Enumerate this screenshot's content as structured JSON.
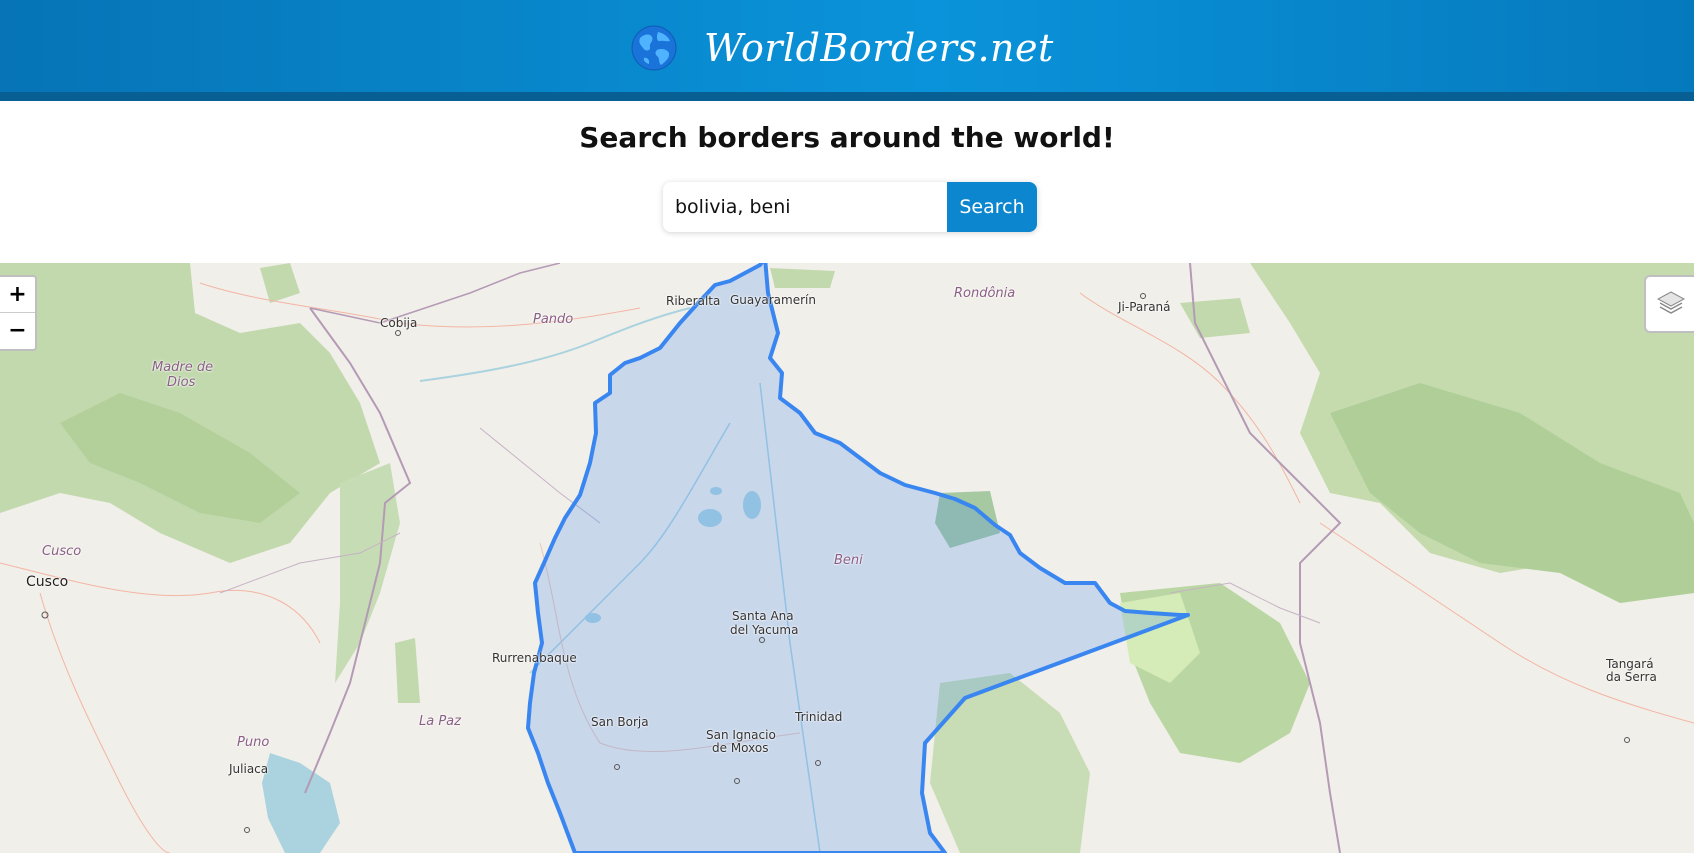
{
  "header": {
    "brand_name": "WorldBorders.net",
    "logo_icon": "globe-icon",
    "colors": {
      "primary": "#0a8ed6",
      "dark": "#085f93"
    }
  },
  "search": {
    "headline": "Search borders around the world!",
    "query": "bolivia, beni",
    "button_label": "Search"
  },
  "map": {
    "highlight_color": "#3a86f0",
    "controls": {
      "zoom_in": "+",
      "zoom_out": "−",
      "layers_icon": "layers-icon"
    },
    "labels": {
      "riberalta": "Riberalta",
      "guayaramerin": "Guayaramerín",
      "rondonia": "Rondônia",
      "ji_parana": "Ji-Paraná",
      "cobija": "Cobija",
      "pando": "Pando",
      "madre_de_dios_1": "Madre de",
      "madre_de_dios_2": "Dios",
      "cusco_region": "Cusco",
      "cusco_city": "Cusco",
      "santa_ana_1": "Santa Ana",
      "santa_ana_2": "del Yacuma",
      "beni": "Beni",
      "rurrenabaque": "Rurrenabaque",
      "san_borja": "San Borja",
      "trinidad": "Trinidad",
      "san_ignacio_1": "San Ignacio",
      "san_ignacio_2": "de Moxos",
      "la_paz": "La Paz",
      "puno": "Puno",
      "juliaca": "Juliaca",
      "tangara_1": "Tangará",
      "tangara_2": "da Serra"
    }
  }
}
